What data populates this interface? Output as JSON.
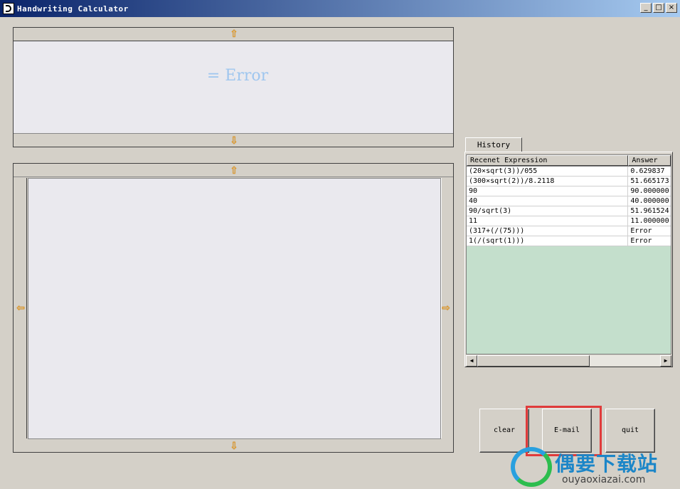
{
  "window": {
    "title": "Handwriting Calculator",
    "minimize": "_",
    "maximize": "□",
    "close": "×"
  },
  "display": {
    "result": "= Error"
  },
  "arrows": {
    "up": "⇧",
    "down": "⇩",
    "left": "⇦",
    "right": "⇨"
  },
  "history": {
    "tab_label": "History",
    "columns": [
      "Recenet Expression",
      "Answer"
    ],
    "rows": [
      [
        "(20×sqrt(3))/055",
        "0.629837"
      ],
      [
        "(300×sqrt(2))/8.2118",
        "51.665173"
      ],
      [
        "90",
        "90.000000"
      ],
      [
        "40",
        "40.000000"
      ],
      [
        "90/sqrt(3)",
        "51.961524"
      ],
      [
        "11",
        "11.000000"
      ],
      [
        "(317+(/(75)))",
        "Error"
      ],
      [
        "1(/(sqrt(1)))",
        "Error"
      ]
    ]
  },
  "buttons": {
    "clear": "clear",
    "email": "E-mail",
    "quit": "quit"
  },
  "watermark": {
    "cn": "偶要下载站",
    "en": "ouyaoxiazai.com"
  },
  "colors": {
    "titlebar": "#0a246a",
    "result_text": "#9fc6ef",
    "list_bg": "#c4dfcc",
    "arrow": "#f29d14",
    "highlight": "#e03b3b"
  }
}
